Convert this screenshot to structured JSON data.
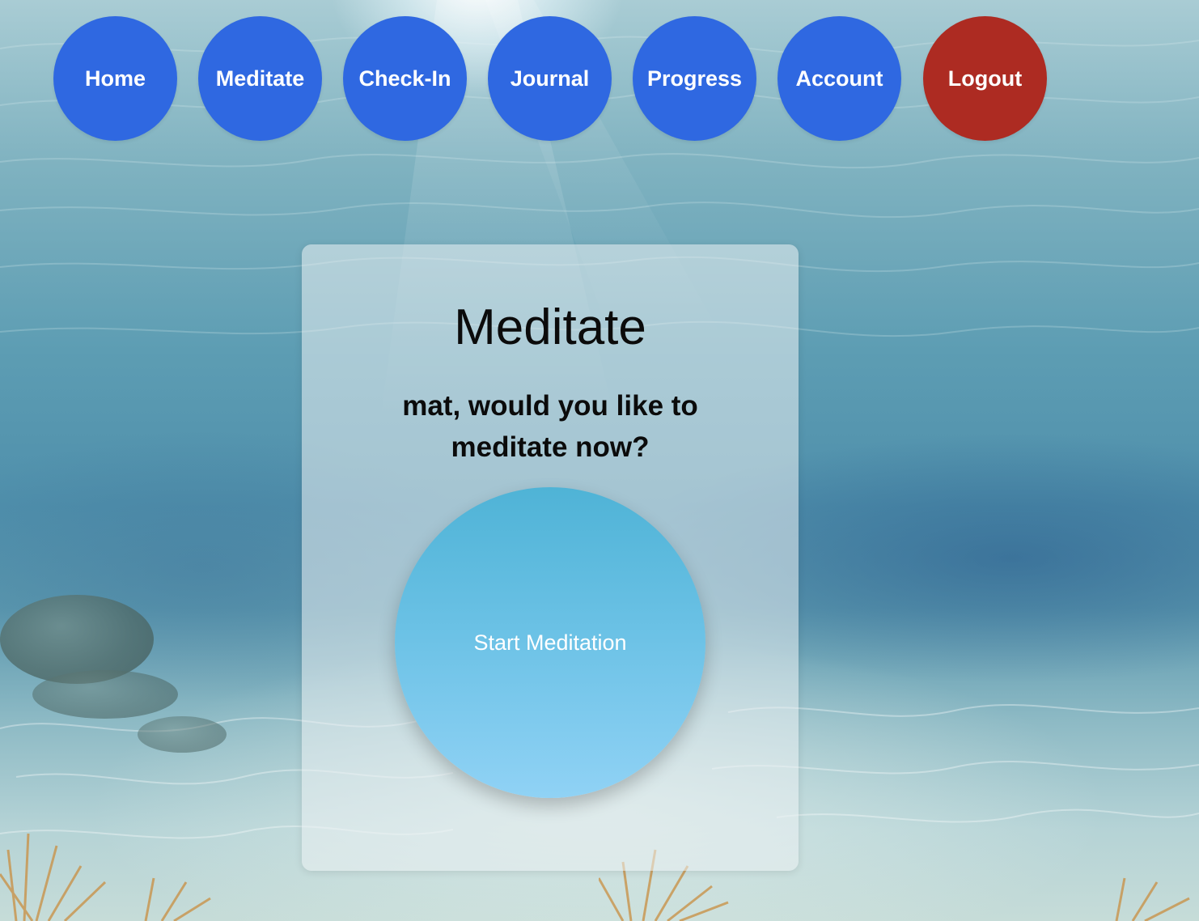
{
  "nav": {
    "items": [
      {
        "label": "Home"
      },
      {
        "label": "Meditate"
      },
      {
        "label": "Check-In"
      },
      {
        "label": "Journal"
      },
      {
        "label": "Progress"
      },
      {
        "label": "Account"
      },
      {
        "label": "Logout"
      }
    ]
  },
  "main": {
    "title": "Meditate",
    "question": "mat, would you like to meditate now?",
    "start_button_label": "Start Meditation"
  },
  "colors": {
    "nav_button": "#2f68e1",
    "logout_button": "#ad2b22",
    "start_button_top": "#4fb3d6",
    "start_button_bottom": "#90d2f5"
  },
  "icons": {
    "background": "underwater-scene"
  }
}
